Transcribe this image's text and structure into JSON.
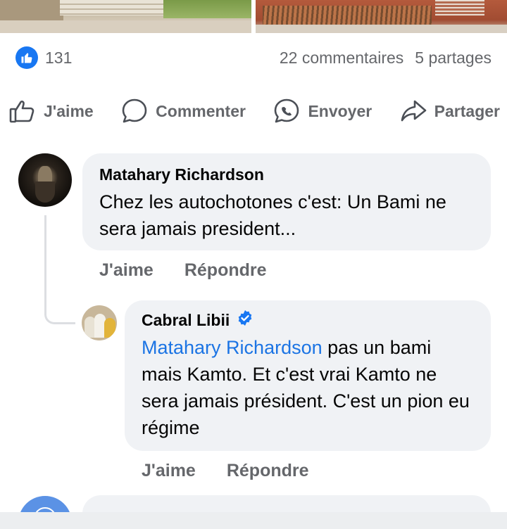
{
  "post": {
    "photos": [
      {
        "name": "post-photo-left"
      },
      {
        "name": "post-photo-right"
      }
    ],
    "stats": {
      "reaction_icon": "like-icon",
      "reaction_count": "131",
      "comments": "22 commentaires",
      "shares": "5 partages"
    },
    "actions": {
      "like": {
        "label": "J'aime",
        "icon": "thumbs-up-icon"
      },
      "comment": {
        "label": "Commenter",
        "icon": "comment-icon"
      },
      "send": {
        "label": "Envoyer",
        "icon": "messenger-icon"
      },
      "share": {
        "label": "Partager",
        "icon": "share-icon"
      }
    }
  },
  "comments": [
    {
      "author": "Matahary Richardson",
      "text": "Chez les autochotones c'est: Un Bami ne sera jamais president...",
      "like_label": "J'aime",
      "reply_label": "Répondre"
    }
  ],
  "reply": {
    "author": "Cabral Libii",
    "verified": true,
    "verified_icon": "verified-badge-icon",
    "mention": "Matahary Richardson",
    "text": " pas un bami mais Kamto. Et c'est vrai Kamto ne sera jamais président. C'est un pion eu régime",
    "like_label": "J'aime",
    "reply_label": "Répondre"
  },
  "colors": {
    "accent": "#1877f2",
    "mention": "#1b74e4",
    "muted_text": "#65676b",
    "bubble_bg": "#f0f2f5"
  }
}
